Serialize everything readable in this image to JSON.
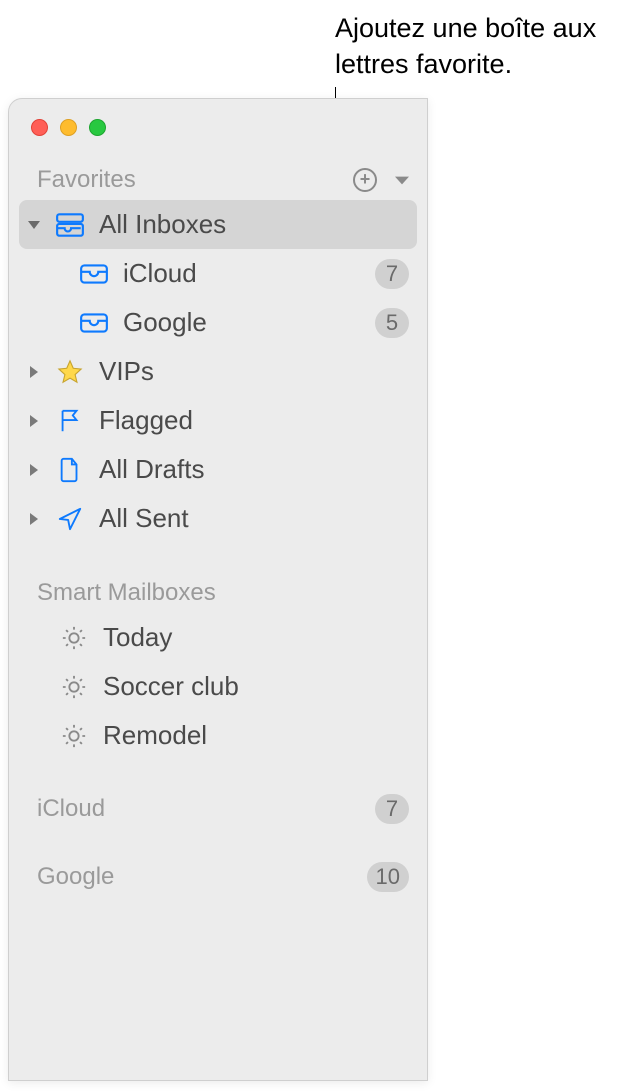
{
  "callout": "Ajoutez une boîte aux lettres favorite.",
  "sections": {
    "favorites": {
      "label": "Favorites",
      "items": [
        {
          "label": "All Inboxes",
          "icon": "inbox-stack-icon",
          "expanded": true,
          "selected": true
        },
        {
          "label": "iCloud",
          "icon": "inbox-icon",
          "badge": "7",
          "child": true
        },
        {
          "label": "Google",
          "icon": "inbox-icon",
          "badge": "5",
          "child": true
        },
        {
          "label": "VIPs",
          "icon": "star-icon",
          "expandable": true
        },
        {
          "label": "Flagged",
          "icon": "flag-icon",
          "expandable": true
        },
        {
          "label": "All Drafts",
          "icon": "draft-icon",
          "expandable": true
        },
        {
          "label": "All Sent",
          "icon": "sent-icon",
          "expandable": true
        }
      ]
    },
    "smart": {
      "label": "Smart Mailboxes",
      "items": [
        {
          "label": "Today",
          "icon": "gear-icon"
        },
        {
          "label": "Soccer club",
          "icon": "gear-icon"
        },
        {
          "label": "Remodel",
          "icon": "gear-icon"
        }
      ]
    },
    "accounts": [
      {
        "label": "iCloud",
        "badge": "7"
      },
      {
        "label": "Google",
        "badge": "10"
      }
    ]
  },
  "colors": {
    "accent": "#0e7afe",
    "star_fill": "#ffd84a",
    "star_stroke": "#c7a42f",
    "muted": "#9a9a9a",
    "badge_bg": "#d0d0d0"
  }
}
